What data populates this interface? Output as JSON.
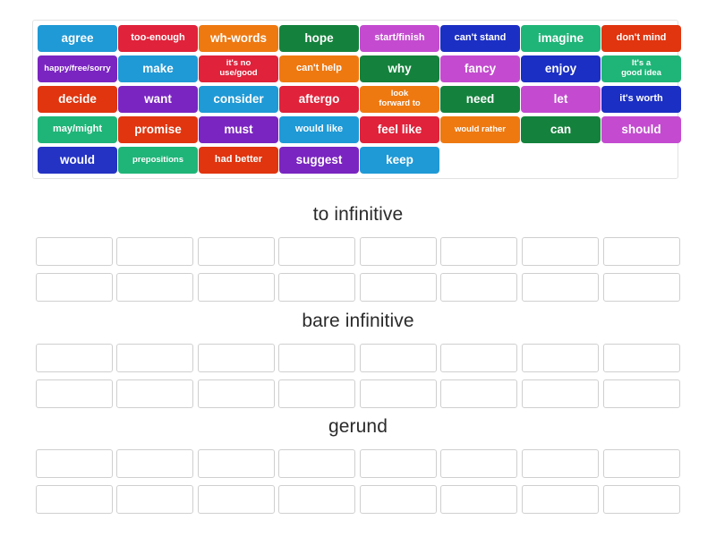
{
  "activity": {
    "type": "group-sort",
    "wordbank": {
      "name": "word-bank",
      "columns": 8,
      "tiles": [
        {
          "label": "agree",
          "color": "#1f9ad6",
          "size": "m"
        },
        {
          "label": "too-enough",
          "color": "#e0223a",
          "size": "s"
        },
        {
          "label": "wh-words",
          "color": "#ef7911",
          "size": "m"
        },
        {
          "label": "hope",
          "color": "#14823c",
          "size": "m"
        },
        {
          "label": "start/finish",
          "color": "#c44bd0",
          "size": "s"
        },
        {
          "label": "can't stand",
          "color": "#1b2fc4",
          "size": "s"
        },
        {
          "label": "imagine",
          "color": "#1fb578",
          "size": "m"
        },
        {
          "label": "don't mind",
          "color": "#e0350f",
          "size": "s"
        },
        {
          "label": "happy/free/sorry",
          "color": "#7a25c1",
          "size": "xs"
        },
        {
          "label": "make",
          "color": "#1f9ad6",
          "size": "m"
        },
        {
          "label": "it's no\nuse/good",
          "color": "#e0223a",
          "size": "two"
        },
        {
          "label": "can't help",
          "color": "#ef7911",
          "size": "s"
        },
        {
          "label": "why",
          "color": "#14823c",
          "size": "m"
        },
        {
          "label": "fancy",
          "color": "#c44bd0",
          "size": "m"
        },
        {
          "label": "enjoy",
          "color": "#1b2fc4",
          "size": "m"
        },
        {
          "label": "It's a\ngood idea",
          "color": "#1fb578",
          "size": "two"
        },
        {
          "label": "decide",
          "color": "#e0350f",
          "size": "m"
        },
        {
          "label": "want",
          "color": "#7a25c1",
          "size": "m"
        },
        {
          "label": "consider",
          "color": "#1f9ad6",
          "size": "m"
        },
        {
          "label": "after go",
          "color": "#e0223a",
          "size": "m",
          "bold_tail": "go"
        },
        {
          "label": "look\nforward to",
          "color": "#ef7911",
          "size": "two"
        },
        {
          "label": "need",
          "color": "#14823c",
          "size": "m"
        },
        {
          "label": "let",
          "color": "#c44bd0",
          "size": "m"
        },
        {
          "label": "it's worth",
          "color": "#1b2fc4",
          "size": "s"
        },
        {
          "label": "may/might",
          "color": "#1fb578",
          "size": "s"
        },
        {
          "label": "promise",
          "color": "#e0350f",
          "size": "m"
        },
        {
          "label": "must",
          "color": "#7a25c1",
          "size": "m"
        },
        {
          "label": "would like",
          "color": "#1f9ad6",
          "size": "s"
        },
        {
          "label": "feel like",
          "color": "#e0223a",
          "size": "m"
        },
        {
          "label": "would rather",
          "color": "#ef7911",
          "size": "xs"
        },
        {
          "label": "can",
          "color": "#14823c",
          "size": "m"
        },
        {
          "label": "should",
          "color": "#c44bd0",
          "size": "m"
        },
        {
          "label": "would",
          "color": "#2433c4",
          "size": "m"
        },
        {
          "label": "prepositions",
          "color": "#1fb578",
          "size": "xs"
        },
        {
          "label": "had better",
          "color": "#e0350f",
          "size": "s"
        },
        {
          "label": "suggest",
          "color": "#7a25c1",
          "size": "m"
        },
        {
          "label": "keep",
          "color": "#1f9ad6",
          "size": "m"
        }
      ]
    },
    "categories": [
      {
        "title": "to infinitive",
        "slots_per_row": 8,
        "rows": 2,
        "filled": []
      },
      {
        "title": "bare infinitive",
        "slots_per_row": 8,
        "rows": 2,
        "filled": []
      },
      {
        "title": "gerund",
        "slots_per_row": 8,
        "rows": 2,
        "filled": []
      }
    ],
    "colors": {
      "azure": "#1f9ad6",
      "red": "#e0223a",
      "orange": "#ef7911",
      "dark_green": "#14823c",
      "magenta": "#c44bd0",
      "royal_blue": "#1b2fc4",
      "emerald": "#1fb578",
      "vermilion": "#e0350f",
      "purple": "#7a25c1",
      "slot_border": "#cfcfcf",
      "bank_border": "#e2e2e2",
      "page_background": "#ffffff",
      "title_text": "#2b2b2b"
    }
  }
}
